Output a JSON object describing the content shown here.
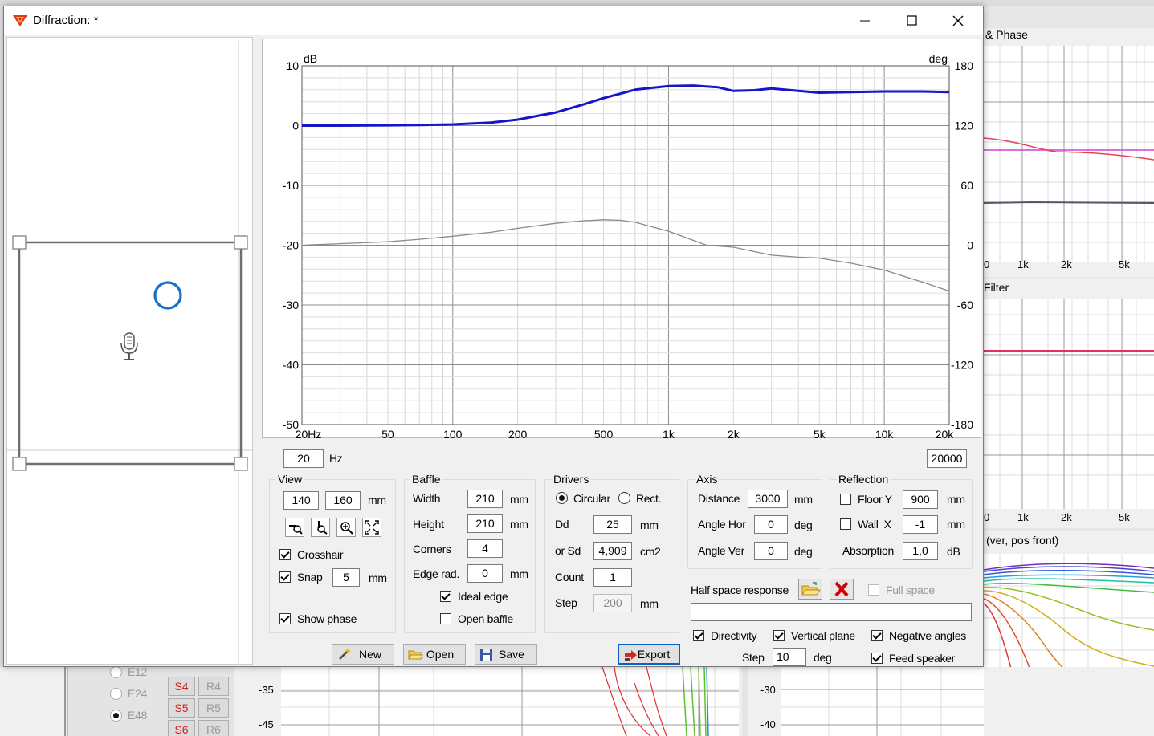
{
  "window": {
    "title": "Diffraction: *"
  },
  "background": {
    "panel_top_title": "& Phase",
    "panel_mid_title": "Filter",
    "panel_bot_title": "(ver, pos front)",
    "top_ticks": [
      "0",
      "1k",
      "2k",
      "5k"
    ],
    "mid_ticks": [
      "0",
      "1k",
      "2k",
      "5k"
    ],
    "left_yticks": [
      "-35",
      "-45"
    ],
    "right_yticks": [
      "-30",
      "-40"
    ],
    "radio_items": [
      "E12",
      "E24",
      "E48"
    ],
    "s_buttons": [
      "S4",
      "S5",
      "S6"
    ],
    "r_buttons": [
      "R4",
      "R5",
      "R6"
    ]
  },
  "chart_data": {
    "type": "line",
    "xscale": "log",
    "xlim": [
      20,
      20000
    ],
    "ylim": [
      -50,
      10
    ],
    "y2lim": [
      -180,
      180
    ],
    "ylabel": "dB",
    "y2label": "deg",
    "xticks": [
      "20Hz",
      "50",
      "100",
      "200",
      "500",
      "1k",
      "2k",
      "5k",
      "10k",
      "20k"
    ],
    "yticks": [
      "10",
      "0",
      "-10",
      "-20",
      "-30",
      "-40",
      "-50"
    ],
    "y2ticks": [
      "180",
      "120",
      "60",
      "0",
      "-60",
      "-120",
      "-180"
    ],
    "grid": true,
    "series": [
      {
        "color": "#1616c8",
        "axis": "left",
        "x": [
          20,
          30,
          50,
          70,
          100,
          150,
          200,
          300,
          400,
          500,
          700,
          1000,
          1300,
          1700,
          2000,
          2500,
          3000,
          4000,
          5000,
          7000,
          10000,
          15000,
          20000
        ],
        "y": [
          0,
          0,
          0.05,
          0.1,
          0.2,
          0.5,
          1.0,
          2.2,
          3.5,
          4.6,
          6.0,
          6.6,
          6.7,
          6.4,
          5.8,
          5.9,
          6.2,
          5.8,
          5.5,
          5.6,
          5.7,
          5.7,
          5.6
        ]
      },
      {
        "color": "#8a8a8a",
        "axis": "right",
        "x": [
          20,
          30,
          50,
          70,
          100,
          150,
          200,
          300,
          400,
          500,
          600,
          700,
          1000,
          1500,
          2000,
          3000,
          4000,
          5000,
          7000,
          10000,
          15000,
          20000
        ],
        "y": [
          0,
          1.5,
          3.5,
          6,
          9,
          13,
          17,
          22,
          24.5,
          25.5,
          25,
          23,
          14,
          0,
          -2,
          -10,
          -12,
          -13,
          -18,
          -25,
          -37,
          -46
        ]
      }
    ]
  },
  "freq_range": {
    "min": "20",
    "unit": "Hz",
    "max": "20000"
  },
  "view": {
    "title": "View",
    "w": "140",
    "h": "160",
    "unit": "mm",
    "crosshair_label": "Crosshair",
    "crosshair": true,
    "snap_label": "Snap",
    "snap": true,
    "snap_value": "5",
    "snap_unit": "mm",
    "show_phase_label": "Show phase",
    "show_phase": true
  },
  "baffle": {
    "title": "Baffle",
    "width_label": "Width",
    "width": "210",
    "width_unit": "mm",
    "height_label": "Height",
    "height": "210",
    "height_unit": "mm",
    "corners_label": "Corners",
    "corners": "4",
    "edge_label": "Edge rad.",
    "edge": "0",
    "edge_unit": "mm",
    "ideal_edge_label": "Ideal edge",
    "ideal_edge": true,
    "open_baffle_label": "Open baffle",
    "open_baffle": false
  },
  "drivers": {
    "title": "Drivers",
    "circular_label": "Circular",
    "rect_label": "Rect.",
    "shape": "circular",
    "dd_label": "Dd",
    "dd": "25",
    "dd_unit": "mm",
    "sd_label": "or Sd",
    "sd": "4,909",
    "sd_unit": "cm2",
    "count_label": "Count",
    "count": "1",
    "step_label": "Step",
    "step": "200",
    "step_unit": "mm"
  },
  "axis": {
    "title": "Axis",
    "distance_label": "Distance",
    "distance": "3000",
    "distance_unit": "mm",
    "hor_label": "Angle Hor",
    "hor": "0",
    "hor_unit": "deg",
    "ver_label": "Angle Ver",
    "ver": "0",
    "ver_unit": "deg"
  },
  "reflection": {
    "title": "Reflection",
    "floor_label": "Floor Y",
    "floor": "900",
    "floor_unit": "mm",
    "floor_on": false,
    "wall_label": "Wall  X",
    "wall": "-1",
    "wall_unit": "mm",
    "wall_on": false,
    "absorption_label": "Absorption",
    "absorption": "1,0",
    "absorption_unit": "dB"
  },
  "half_space": {
    "label": "Half space response",
    "value": "",
    "full_space_label": "Full space",
    "full_space": false
  },
  "directivity": {
    "directivity_label": "Directivity",
    "directivity": true,
    "vertical_label": "Vertical plane",
    "vertical": true,
    "negative_label": "Negative angles",
    "negative": true,
    "step_label": "Step",
    "step": "10",
    "step_unit": "deg",
    "feed_label": "Feed speaker",
    "feed": true
  },
  "buttons": {
    "new": "New",
    "open": "Open",
    "save": "Save",
    "export": "Export"
  },
  "colors": {
    "accent": "#1f6fc1",
    "magnitude": "#1616c8",
    "phase": "#8a8a8a",
    "delete": "#d40000"
  }
}
